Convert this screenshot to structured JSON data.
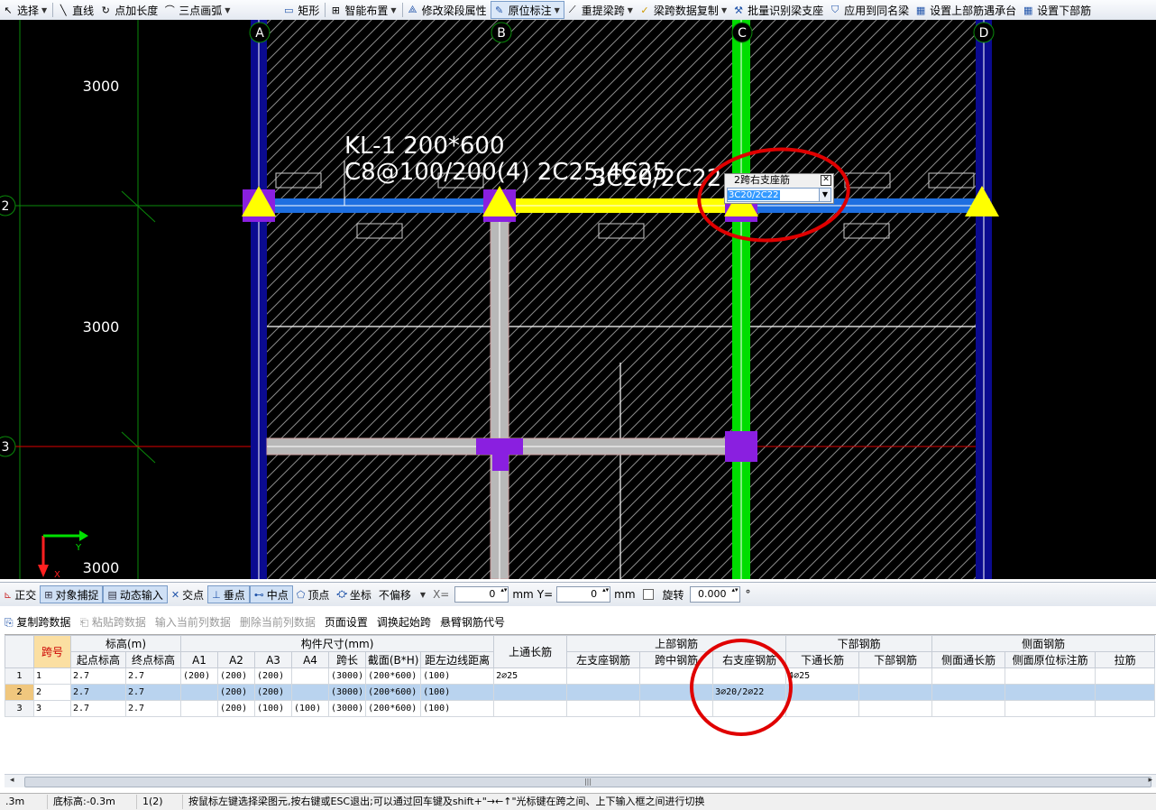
{
  "toolbar": {
    "items": [
      {
        "label": "选择",
        "icon": "cursor-arrow-icon",
        "dropdown": true
      },
      {
        "label": "直线",
        "icon": "line-icon"
      },
      {
        "label": "点加长度",
        "icon": "point-length-icon"
      },
      {
        "label": "三点画弧",
        "icon": "arc-icon",
        "dropdown": true
      },
      {
        "label": "矩形",
        "icon": "rectangle-icon"
      },
      {
        "label": "智能布置",
        "icon": "smart-layout-icon",
        "dropdown": true
      },
      {
        "label": "修改梁段属性",
        "icon": "edit-beam-property-icon"
      },
      {
        "label": "原位标注",
        "icon": "in-place-annotation-icon",
        "dropdown": true,
        "active": true
      },
      {
        "label": "重提梁跨",
        "icon": "re-extract-span-icon",
        "dropdown": true
      },
      {
        "label": "梁跨数据复制",
        "icon": "copy-span-data-icon",
        "dropdown": true
      },
      {
        "label": "批量识别梁支座",
        "icon": "batch-identify-support-icon"
      },
      {
        "label": "应用到同名梁",
        "icon": "apply-same-name-icon"
      },
      {
        "label": "设置上部筋遇承台",
        "icon": "set-top-rebar-icon"
      },
      {
        "label": "设置下部筋",
        "icon": "set-bottom-rebar-icon"
      }
    ]
  },
  "canvas": {
    "axes_top": [
      "A",
      "B",
      "C",
      "D"
    ],
    "axes_left": [
      "2",
      "3"
    ],
    "dimensions": [
      "3000",
      "3000",
      "3000"
    ],
    "beam_label_line1": "KL-1 200*600",
    "beam_label_line2": "C8@100/200(4) 2C25;4C25",
    "support_label": "3C20/2C22",
    "ucs_y": "Y",
    "ucs_x": "X",
    "inplace": {
      "caption": "2跨右支座筋",
      "value": "3C20/2C22",
      "close": "✕"
    },
    "colors": {
      "beam_blue": "#1e6fe0",
      "beam_yellow": "#ffff00",
      "beam_green": "#00dd00",
      "column_purple": "#8a1fe0",
      "wall_navy": "#0b0b90",
      "circle_red": "#e00000"
    }
  },
  "snapbar": {
    "items": [
      {
        "label": "正交",
        "icon": "ortho-icon"
      },
      {
        "label": "对象捕捉",
        "icon": "object-snap-icon",
        "on": true
      },
      {
        "label": "动态输入",
        "icon": "dynamic-input-icon",
        "on": true
      },
      {
        "label": "交点",
        "icon": "intersection-icon"
      },
      {
        "label": "垂点",
        "icon": "perpendicular-icon",
        "on": true
      },
      {
        "label": "中点",
        "icon": "midpoint-icon",
        "on": true
      },
      {
        "label": "顶点",
        "icon": "vertex-icon"
      },
      {
        "label": "坐标",
        "icon": "coordinate-icon"
      }
    ],
    "offset_select": "不偏移",
    "x_label": "X=",
    "x_value": "0",
    "y_label": "Y=",
    "y_value": "0",
    "unit": "mm",
    "rotate_label": "旋转",
    "rotate_value": "0.000",
    "degree": "°"
  },
  "actbar": {
    "items": [
      {
        "label": "复制跨数据",
        "disabled": false
      },
      {
        "label": "粘贴跨数据",
        "disabled": true
      },
      {
        "label": "输入当前列数据",
        "disabled": true
      },
      {
        "label": "删除当前列数据",
        "disabled": true
      },
      {
        "label": "页面设置",
        "disabled": false
      },
      {
        "label": "调换起始跨",
        "disabled": false
      },
      {
        "label": "悬臂钢筋代号",
        "disabled": false
      }
    ]
  },
  "grid": {
    "group_headers": {
      "span": "跨号",
      "elev": "标高(m)",
      "size": "构件尺寸(mm)",
      "top_through": "上通长筋",
      "top": "上部钢筋",
      "bottom": "下部钢筋",
      "side": "侧面钢筋"
    },
    "sub_headers": [
      "起点标高",
      "终点标高",
      "A1",
      "A2",
      "A3",
      "A4",
      "跨长",
      "截面(B*H)",
      "距左边线距离",
      "左支座钢筋",
      "跨中钢筋",
      "右支座钢筋",
      "下通长筋",
      "下部钢筋",
      "侧面通长筋",
      "侧面原位标注筋",
      "拉筋"
    ],
    "rows": [
      {
        "rn": "1",
        "span": "1",
        "s": "2.7",
        "e": "2.7",
        "a1": "(200)",
        "a2": "(200)",
        "a3": "(200)",
        "a4": "",
        "len": "(3000)",
        "sec": "(200*600)",
        "dist": "(100)",
        "tt": "2⌀25",
        "ls": "",
        "mid": "",
        "rs": "",
        "bt": "4⌀25",
        "bb": "",
        "st": "",
        "so": "",
        "tie": ""
      },
      {
        "rn": "2",
        "span": "2",
        "s": "2.7",
        "e": "2.7",
        "a1": "",
        "a2": "(200)",
        "a3": "(200)",
        "a4": "",
        "len": "(3000)",
        "sec": "(200*600)",
        "dist": "(100)",
        "tt": "",
        "ls": "",
        "mid": "",
        "rs": "3⌀20/2⌀22",
        "bt": "",
        "bb": "",
        "st": "",
        "so": "",
        "tie": ""
      },
      {
        "rn": "3",
        "span": "3",
        "s": "2.7",
        "e": "2.7",
        "a1": "",
        "a2": "(200)",
        "a3": "(100)",
        "a4": "(100)",
        "len": "(3000)",
        "sec": "(200*600)",
        "dist": "(100)",
        "tt": "",
        "ls": "",
        "mid": "",
        "rs": "",
        "bt": "",
        "bb": "",
        "st": "",
        "so": "",
        "tie": ""
      }
    ]
  },
  "status": {
    "elev": ".3m",
    "bottom": "底标高:-0.3m",
    "count": "1(2)",
    "hint": "按鼠标左键选择梁图元,按右键或ESC退出;可以通过回车键及shift+\"→←↑\"光标键在跨之间、上下输入框之间进行切换"
  }
}
